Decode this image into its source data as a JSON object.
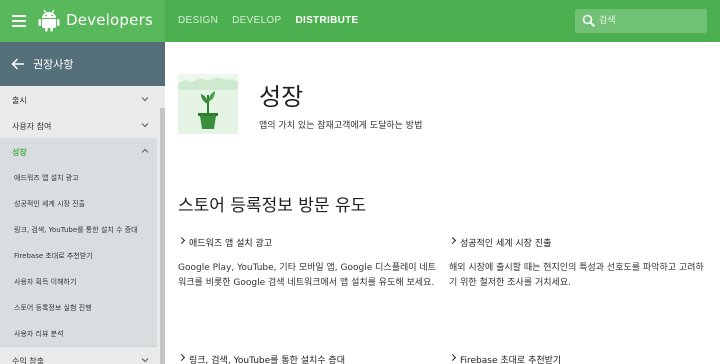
{
  "header": {
    "brand": "Developers",
    "nav": [
      {
        "label": "DESIGN",
        "active": false
      },
      {
        "label": "DEVELOP",
        "active": false
      },
      {
        "label": "DISTRIBUTE",
        "active": true
      }
    ],
    "search_placeholder": "검색"
  },
  "sidebar": {
    "title": "권장사항",
    "items": [
      {
        "label": "출시"
      },
      {
        "label": "사용자 참여"
      },
      {
        "label": "성장"
      }
    ],
    "sub_items": [
      {
        "label": "애드워즈 앱 설치 광고"
      },
      {
        "label": "성공적인 세계 시장 진출"
      },
      {
        "label": "링크, 검색, YouTube를 통한 설치 수 증대"
      },
      {
        "label": "Firebase 초대로 추천받기"
      },
      {
        "label": "사용자 획득 이해하기"
      },
      {
        "label": "스토어 등록정보 실험 진행"
      },
      {
        "label": "사용자 리뷰 분석"
      }
    ],
    "bottom_item": {
      "label": "수익 창출"
    }
  },
  "main": {
    "title": "성장",
    "subtitle": "앱의 가치 있는 잠재고객에게 도달하는 방법",
    "section_title": "스토어 등록정보 방문 유도",
    "cards": [
      {
        "title": "애드워즈 앱 설치 광고",
        "desc": "Google Play, YouTube, 기타 모바일 앱, Google 디스플레이 네트워크를 비롯한 Google 검색 네트워크에서 앱 설치를 유도해 보세요."
      },
      {
        "title": "성공적인 세계 시장 진출",
        "desc": "해외 시장에 출시할 때는 현지인의 특성과 선호도를 파악하고 고려하기 위한 철저한 조사를 거치세요."
      },
      {
        "title": "링크, 검색, YouTube를 통한 설치수 증대",
        "desc": ""
      },
      {
        "title": "Firebase 초대로 추천받기",
        "desc": ""
      }
    ]
  },
  "colors": {
    "accent": "#4caf50",
    "sidebar_header": "#546e7a"
  }
}
